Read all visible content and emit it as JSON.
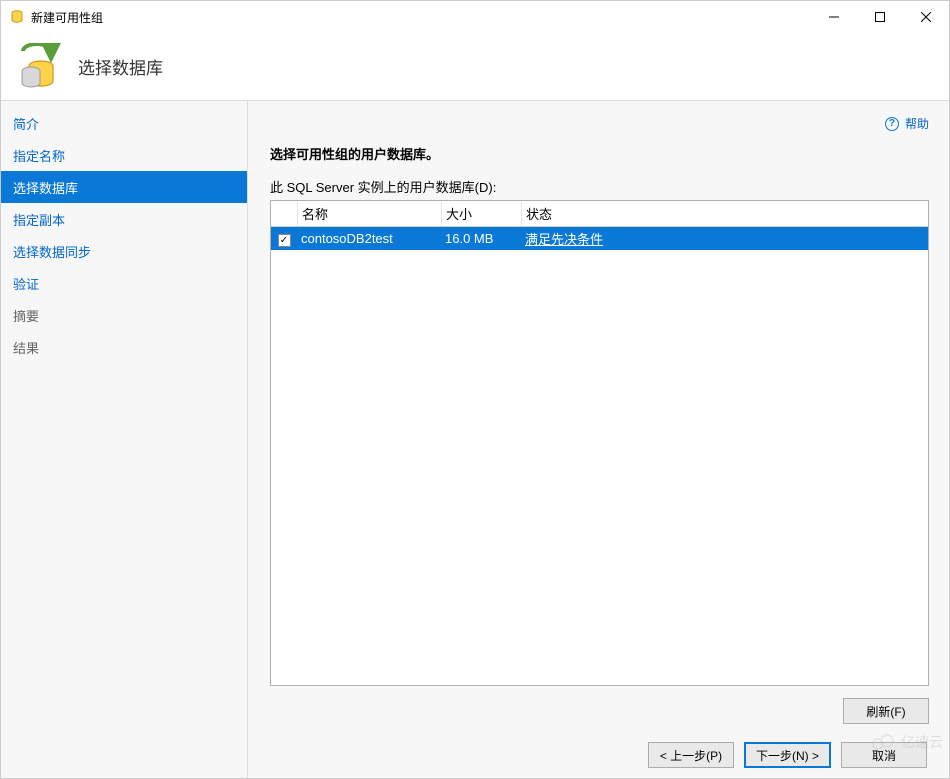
{
  "window": {
    "title": "新建可用性组"
  },
  "header": {
    "title": "选择数据库"
  },
  "sidebar": {
    "items": [
      {
        "label": "简介"
      },
      {
        "label": "指定名称"
      },
      {
        "label": "选择数据库"
      },
      {
        "label": "指定副本"
      },
      {
        "label": "选择数据同步"
      },
      {
        "label": "验证"
      },
      {
        "label": "摘要"
      },
      {
        "label": "结果"
      }
    ]
  },
  "main": {
    "help": "帮助",
    "instruction": "选择可用性组的用户数据库。",
    "subinstruction": "此 SQL Server 实例上的用户数据库(D):",
    "columns": {
      "name": "名称",
      "size": "大小",
      "status": "状态"
    },
    "rows": [
      {
        "checked": true,
        "name": "contosoDB2test",
        "size": "16.0 MB",
        "status": "满足先决条件"
      }
    ],
    "refresh": "刷新(F)"
  },
  "nav": {
    "prev": "< 上一步(P)",
    "next": "下一步(N) >",
    "cancel": "取消"
  },
  "watermark": "亿速云"
}
